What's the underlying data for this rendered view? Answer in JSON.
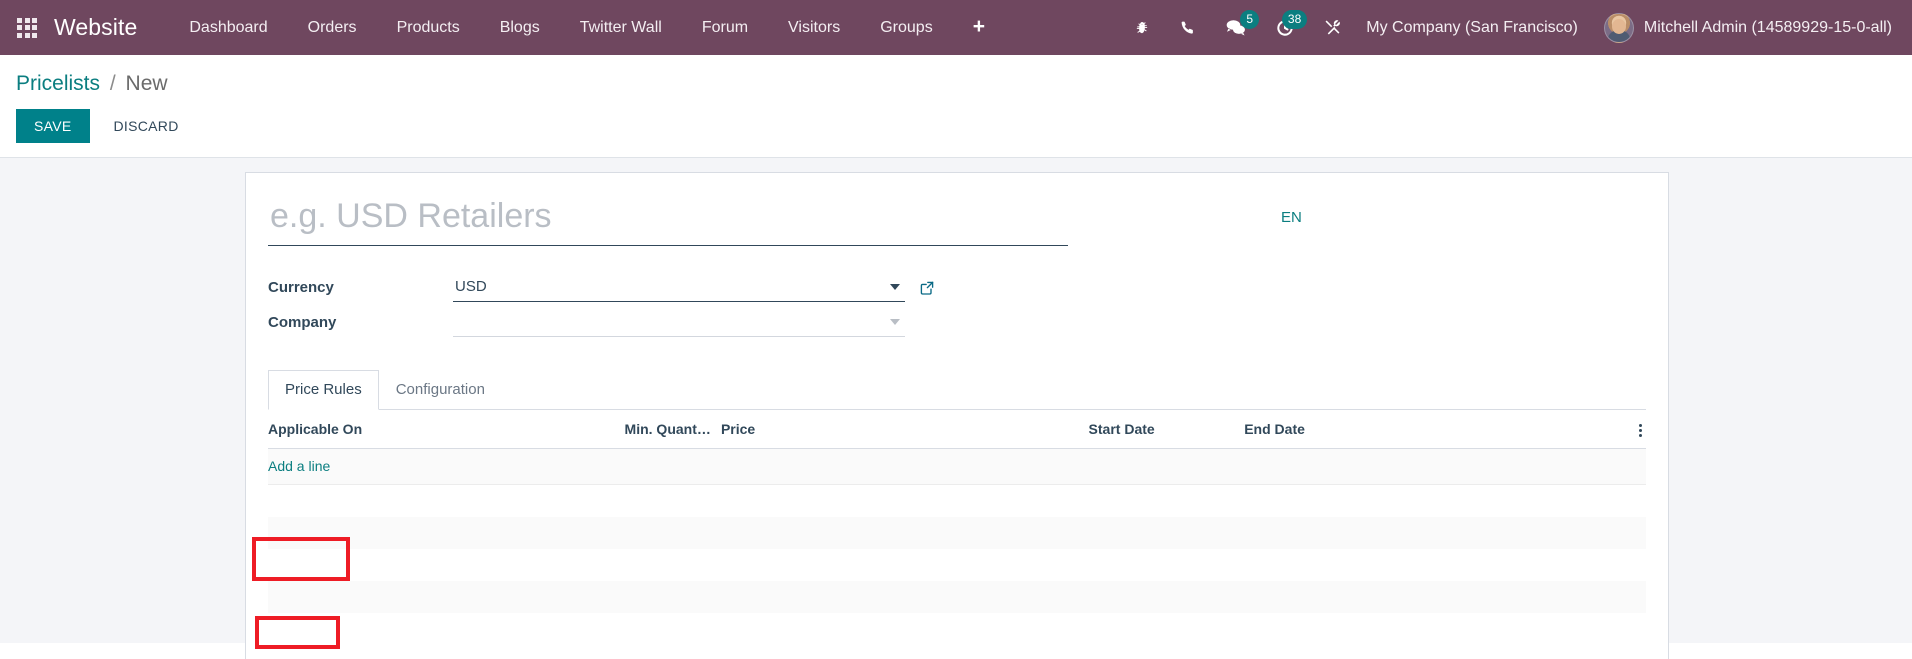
{
  "navbar": {
    "apps_icon": "apps-grid-icon",
    "brand": "Website",
    "menu_items": [
      {
        "label": "Dashboard"
      },
      {
        "label": "Orders"
      },
      {
        "label": "Products"
      },
      {
        "label": "Blogs"
      },
      {
        "label": "Twitter Wall"
      },
      {
        "label": "Forum"
      },
      {
        "label": "Visitors"
      },
      {
        "label": "Groups"
      }
    ],
    "add_label": "+",
    "systray": {
      "bug_icon": "bug-icon",
      "phone_icon": "phone-icon",
      "messages_icon": "chat-bubbles-icon",
      "messages_count": "5",
      "activities_icon": "clock-activity-icon",
      "activities_count": "38",
      "tools_icon": "wrench-screwdriver-icon"
    },
    "company": "My Company (San Francisco)",
    "user": "Mitchell Admin (14589929-15-0-all)",
    "avatar_name": "user-avatar"
  },
  "control_panel": {
    "breadcrumb_root": "Pricelists",
    "breadcrumb_separator": "/",
    "breadcrumb_current": "New",
    "save_label": "SAVE",
    "discard_label": "DISCARD"
  },
  "form": {
    "title_placeholder": "e.g. USD Retailers",
    "title_value": "",
    "language_code": "EN",
    "fields": [
      {
        "label": "Currency",
        "value": "USD",
        "placeholder": "",
        "state": "filled",
        "has_external_link": true
      },
      {
        "label": "Company",
        "value": "",
        "placeholder": "",
        "state": "empty",
        "has_external_link": false
      }
    ],
    "external_link_icon": "external-link-icon",
    "dropdown_icon": "chevron-down-icon"
  },
  "notebook": {
    "tabs": [
      {
        "label": "Price Rules",
        "active": true
      },
      {
        "label": "Configuration",
        "active": false
      }
    ]
  },
  "price_rules_table": {
    "columns": [
      "Applicable On",
      "Min. Quant…",
      "Price",
      "Start Date",
      "End Date"
    ],
    "options_icon": "vertical-dots-icon",
    "add_line_label": "Add a line",
    "rows": []
  },
  "annotations": [
    {
      "name": "price-rules-tab-highlight",
      "color": "#ee1c25",
      "target": "Price Rules"
    },
    {
      "name": "add-a-line-highlight",
      "color": "#ee1c25",
      "target": "Add a line"
    }
  ],
  "colors": {
    "navbar_bg": "#6f475f",
    "accent_teal": "#00818a",
    "badge_bg": "#0b7e80",
    "page_bg": "#f4f5f8",
    "annotation_red": "#ee1c25"
  }
}
